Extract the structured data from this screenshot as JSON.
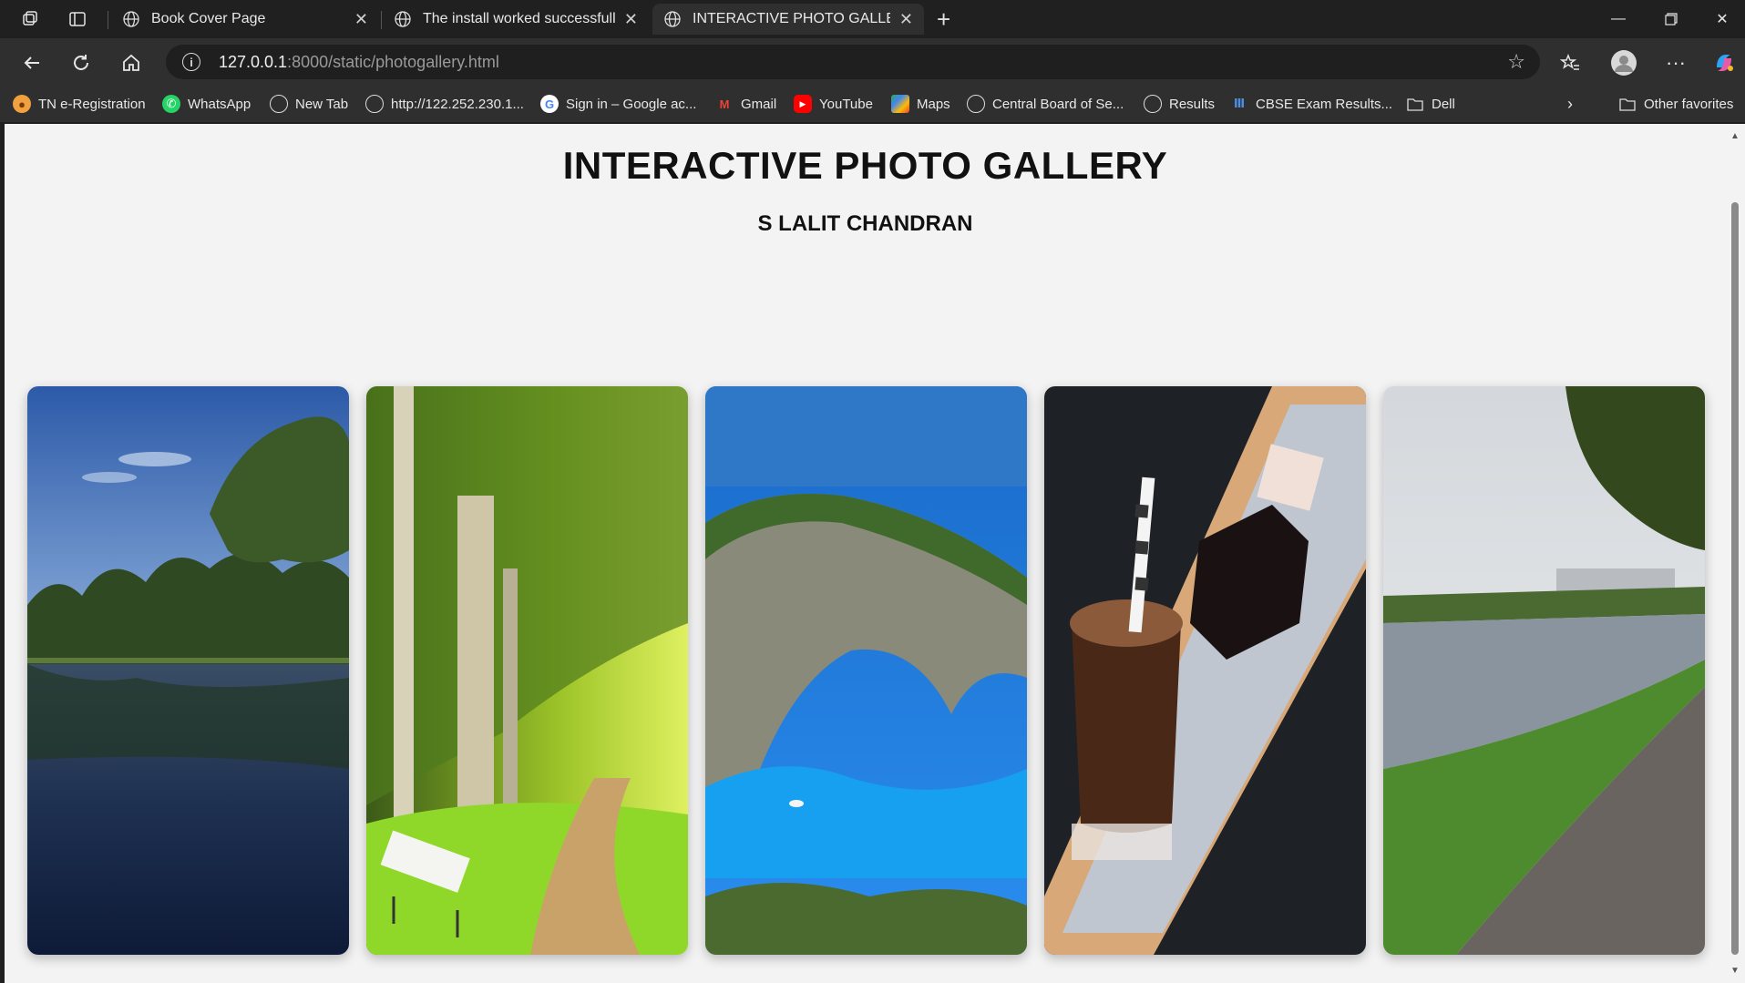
{
  "browser": {
    "tabs": [
      {
        "title": "Book Cover Page"
      },
      {
        "title": "The install worked successfully! Co"
      },
      {
        "title": "INTERACTIVE PHOTO GALLERY"
      }
    ],
    "new_tab": "+",
    "address": {
      "host": "127.0.0.1",
      "path": ":8000/static/photogallery.html"
    },
    "bookmarks": [
      {
        "label": "TN e-Registration",
        "icon": "tn-logo-icon"
      },
      {
        "label": "WhatsApp",
        "icon": "whatsapp-icon"
      },
      {
        "label": "New Tab",
        "icon": "globe-icon"
      },
      {
        "label": "http://122.252.230.1...",
        "icon": "globe-icon"
      },
      {
        "label": "Sign in – Google ac...",
        "icon": "google-icon"
      },
      {
        "label": "Gmail",
        "icon": "gmail-icon"
      },
      {
        "label": "YouTube",
        "icon": "youtube-icon"
      },
      {
        "label": "Maps",
        "icon": "maps-icon"
      },
      {
        "label": "Central Board of Se...",
        "icon": "globe-icon"
      },
      {
        "label": "Results",
        "icon": "globe-icon"
      },
      {
        "label": "CBSE Exam Results...",
        "icon": "cbse-icon"
      },
      {
        "label": "Dell",
        "icon": "folder-icon"
      }
    ],
    "other_favorites": "Other favorites"
  },
  "page": {
    "title": "INTERACTIVE PHOTO GALLERY",
    "author": "S LALIT CHANDRAN",
    "photos": [
      {
        "subject": "lake with trees reflection"
      },
      {
        "subject": "park path with bench"
      },
      {
        "subject": "coastal cliff and blue sea"
      },
      {
        "subject": "chocolate drink and desserts on tray"
      },
      {
        "subject": "riverside walkway"
      }
    ]
  }
}
